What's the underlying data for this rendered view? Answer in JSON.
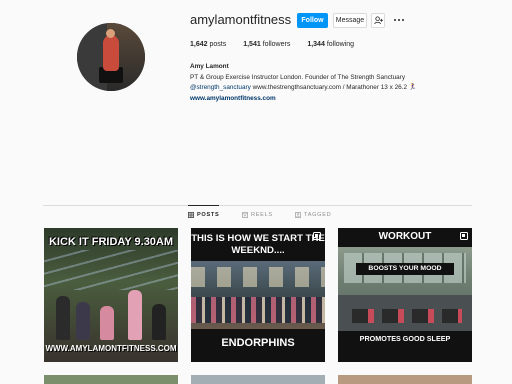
{
  "profile": {
    "username": "amylamontfitness",
    "follow_label": "Follow",
    "message_label": "Message",
    "stats": {
      "posts_count": "1,642",
      "posts_label": "posts",
      "followers_count": "1,541",
      "followers_label": "followers",
      "following_count": "1,344",
      "following_label": "following"
    },
    "bio": {
      "name": "Amy Lamont",
      "line1": "PT & Group Exercise Instructor London. Founder of The Strength Sanctuary",
      "line2_handle": "@strength_sanctuary",
      "line2_rest": " www.thestrengthsanctuary.com / Marathoner 13 x 26.2 🏃‍♀️",
      "website": "www.amylamontfitness.com"
    }
  },
  "tabs": [
    {
      "label": "POSTS",
      "icon": "grid-icon",
      "active": true
    },
    {
      "label": "REELS",
      "icon": "reels-icon",
      "active": false
    },
    {
      "label": "TAGGED",
      "icon": "tagged-icon",
      "active": false
    }
  ],
  "posts": [
    {
      "caption_top": "KICK IT FRIDAY 9.30AM",
      "caption_bottom": "WWW.AMYLAMONTFITNESS.COM",
      "multi": false
    },
    {
      "caption_top": "THIS IS HOW WE START THE WEEKND....",
      "caption_bottom": "ENDORPHINS",
      "multi": true
    },
    {
      "caption_top": "WORKOUT",
      "label": "BOOSTS YOUR MOOD",
      "caption_bottom": "PROMOTES GOOD SLEEP",
      "multi": true
    }
  ],
  "colors": {
    "accent": "#0095f6",
    "link": "#00376b",
    "background": "#fafafa"
  }
}
